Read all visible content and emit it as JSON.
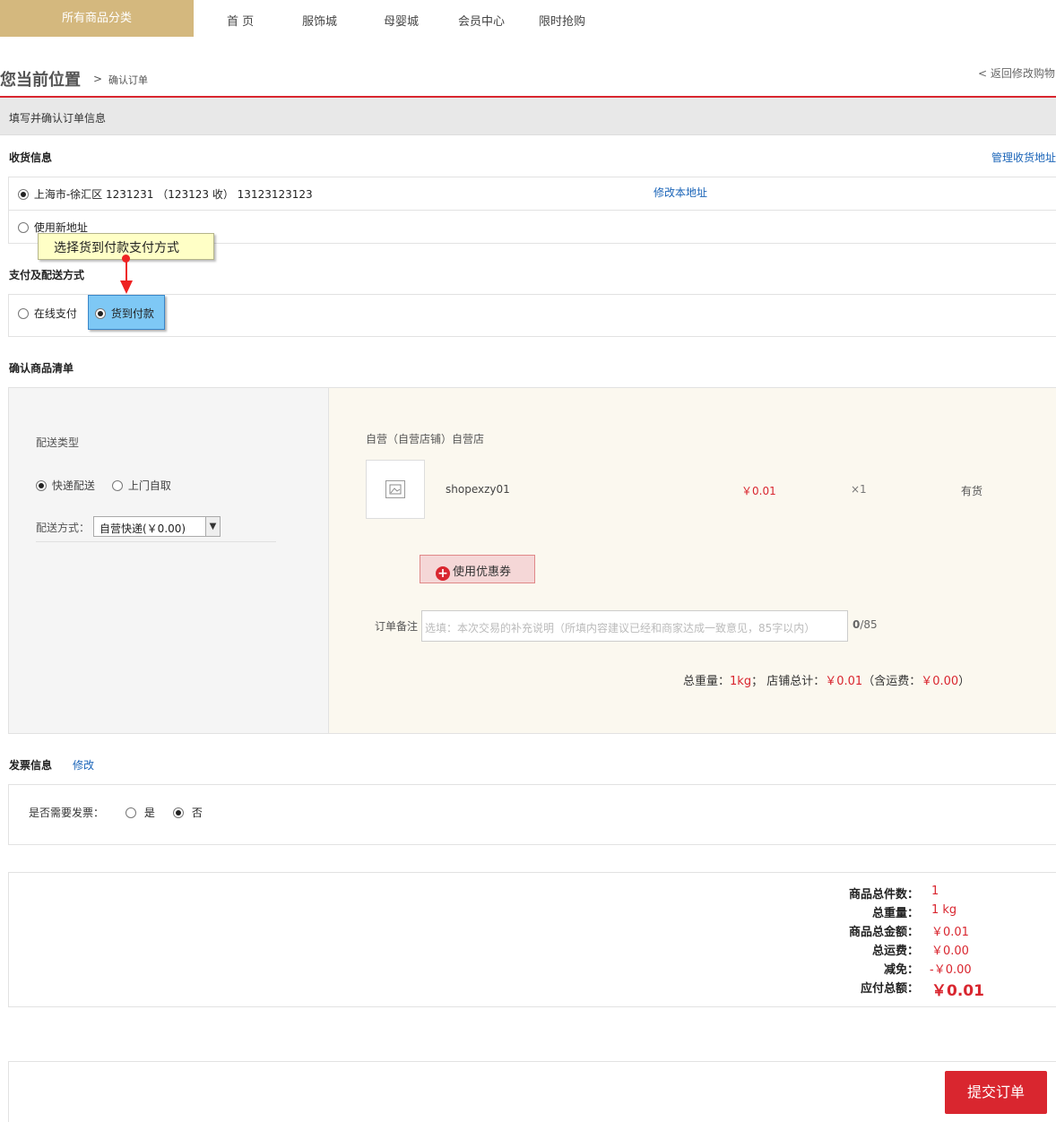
{
  "nav": {
    "all_categories": "所有商品分类",
    "links": [
      "首 页",
      "服饰城",
      "母婴城",
      "会员中心",
      "限时抢购"
    ]
  },
  "breadcrumb": {
    "title": "您当前位置",
    "separator": ">",
    "current": "确认订单",
    "back": "< 返回修改购物"
  },
  "header_bar": "填写并确认订单信息",
  "address": {
    "title": "收货信息",
    "manage": "管理收货地址",
    "selected": "上海市-徐汇区 1231231 （123123 收） 13123123123",
    "edit": "修改本地址",
    "new": "使用新地址"
  },
  "tooltip": "选择货到付款支付方式",
  "payment": {
    "title": "支付及配送方式",
    "online": "在线支付",
    "cod": "货到付款"
  },
  "items": {
    "title": "确认商品清单",
    "delivery_type_label": "配送类型",
    "express": "快递配送",
    "pickup": "上门自取",
    "method_label": "配送方式：",
    "method_value": "自营快递(￥0.00)",
    "store": "自营（自营店铺）自营店",
    "product_name": "shopexzy01",
    "price": "￥0.01",
    "qty": "×1",
    "stock": "有货",
    "coupon": "使用优惠券",
    "remark_label": "订单备注",
    "remark_placeholder": "选填：本次交易的补充说明（所填内容建议已经和商家达成一致意见，85字以内）",
    "remark_count": "0",
    "remark_max": "/85",
    "summary_weight_label": "总重量：",
    "summary_weight": "1kg",
    "summary_sep": "；",
    "summary_store_label": "店铺总计：",
    "summary_store": "￥0.01",
    "summary_ship_open": "（含运费：",
    "summary_ship": "￥0.00",
    "summary_ship_close": "）"
  },
  "invoice": {
    "title": "发票信息",
    "edit": "修改",
    "question": "是否需要发票：",
    "yes": "是",
    "no": "否"
  },
  "totals": {
    "count_label": "商品总件数：",
    "count": "1",
    "weight_label": "总重量：",
    "weight": "1 kg",
    "amount_label": "商品总金额：",
    "amount": "￥0.01",
    "freight_label": "总运费：",
    "freight": "￥0.00",
    "discount_label": "减免：",
    "discount": "-￥0.00",
    "payable_label": "应付总额：",
    "payable": "￥0.01"
  },
  "submit": "提交订单",
  "colors": {
    "accent_red": "#d9262f",
    "gold": "#d4b87e",
    "link_blue": "#1a64b8"
  }
}
